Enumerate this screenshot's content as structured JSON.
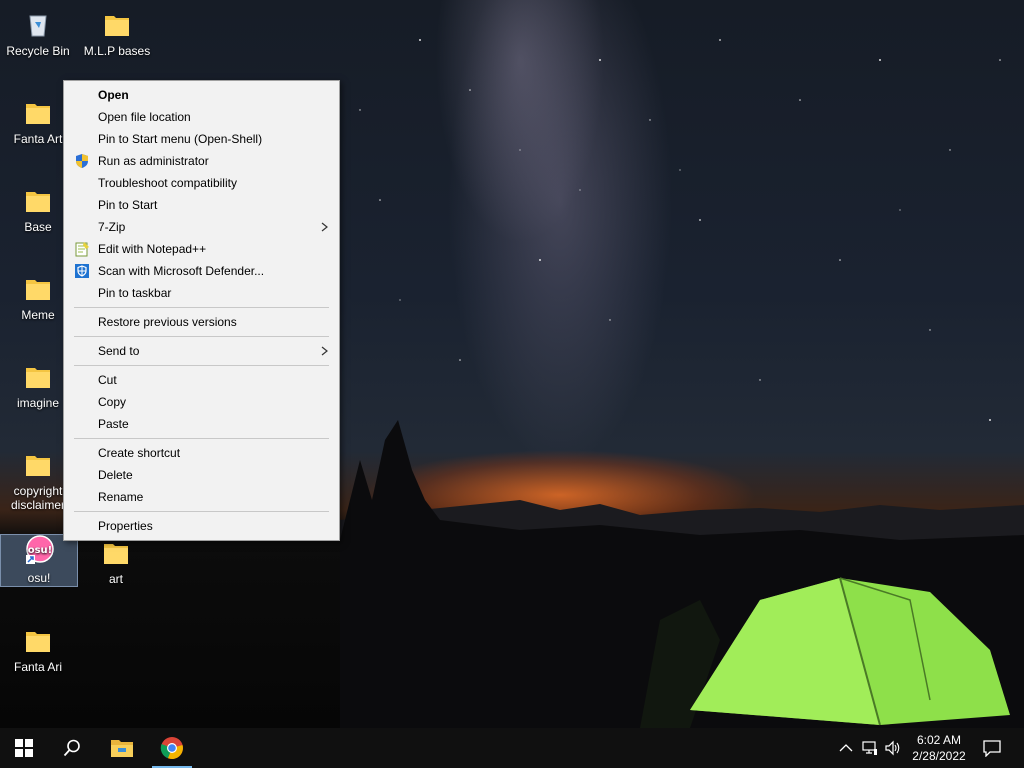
{
  "desktop": {
    "icons": [
      {
        "label": "Recycle Bin",
        "icon": "recycle-bin-icon"
      },
      {
        "label": "M.L.P bases",
        "icon": "folder-icon"
      },
      {
        "label": "Fanta Art",
        "icon": "folder-icon"
      },
      {
        "label": "Base",
        "icon": "folder-icon"
      },
      {
        "label": "Meme",
        "icon": "folder-icon"
      },
      {
        "label": "imagine",
        "icon": "folder-icon"
      },
      {
        "label": "copyright disclaimer",
        "icon": "folder-icon"
      },
      {
        "label": "osu!",
        "icon": "osu-icon"
      },
      {
        "label": "art",
        "icon": "folder-icon"
      },
      {
        "label": "Fanta Ari",
        "icon": "folder-icon"
      }
    ]
  },
  "context_menu": {
    "items": [
      {
        "label": "Open"
      },
      {
        "label": "Open file location"
      },
      {
        "label": "Pin to Start menu (Open-Shell)"
      },
      {
        "label": "Run as administrator",
        "icon": "uac-shield-icon"
      },
      {
        "label": "Troubleshoot compatibility"
      },
      {
        "label": "Pin to Start"
      },
      {
        "label": "7-Zip"
      },
      {
        "label": "Edit with Notepad++",
        "icon": "notepad-plus-plus-icon"
      },
      {
        "label": "Scan with Microsoft Defender...",
        "icon": "defender-icon"
      },
      {
        "label": "Pin to taskbar"
      },
      {
        "label": "Restore previous versions"
      },
      {
        "label": "Send to"
      },
      {
        "label": "Cut"
      },
      {
        "label": "Copy"
      },
      {
        "label": "Paste"
      },
      {
        "label": "Create shortcut"
      },
      {
        "label": "Delete"
      },
      {
        "label": "Rename"
      },
      {
        "label": "Properties"
      }
    ]
  },
  "taskbar": {
    "buttons": [
      "windows-start-icon",
      "search-icon",
      "file-explorer-icon",
      "chrome-icon"
    ],
    "tray": [
      "chevron-up-icon",
      "network-icon",
      "volume-icon",
      "notification-icon"
    ],
    "time": "6:02 AM",
    "date": "2/28/2022"
  },
  "colors": {
    "menu_bg": "#f2f2f2",
    "taskbar_bg": "#101010",
    "folder": "#f4c542",
    "tent": "#8ee04a",
    "accent": "#76b9ed"
  }
}
